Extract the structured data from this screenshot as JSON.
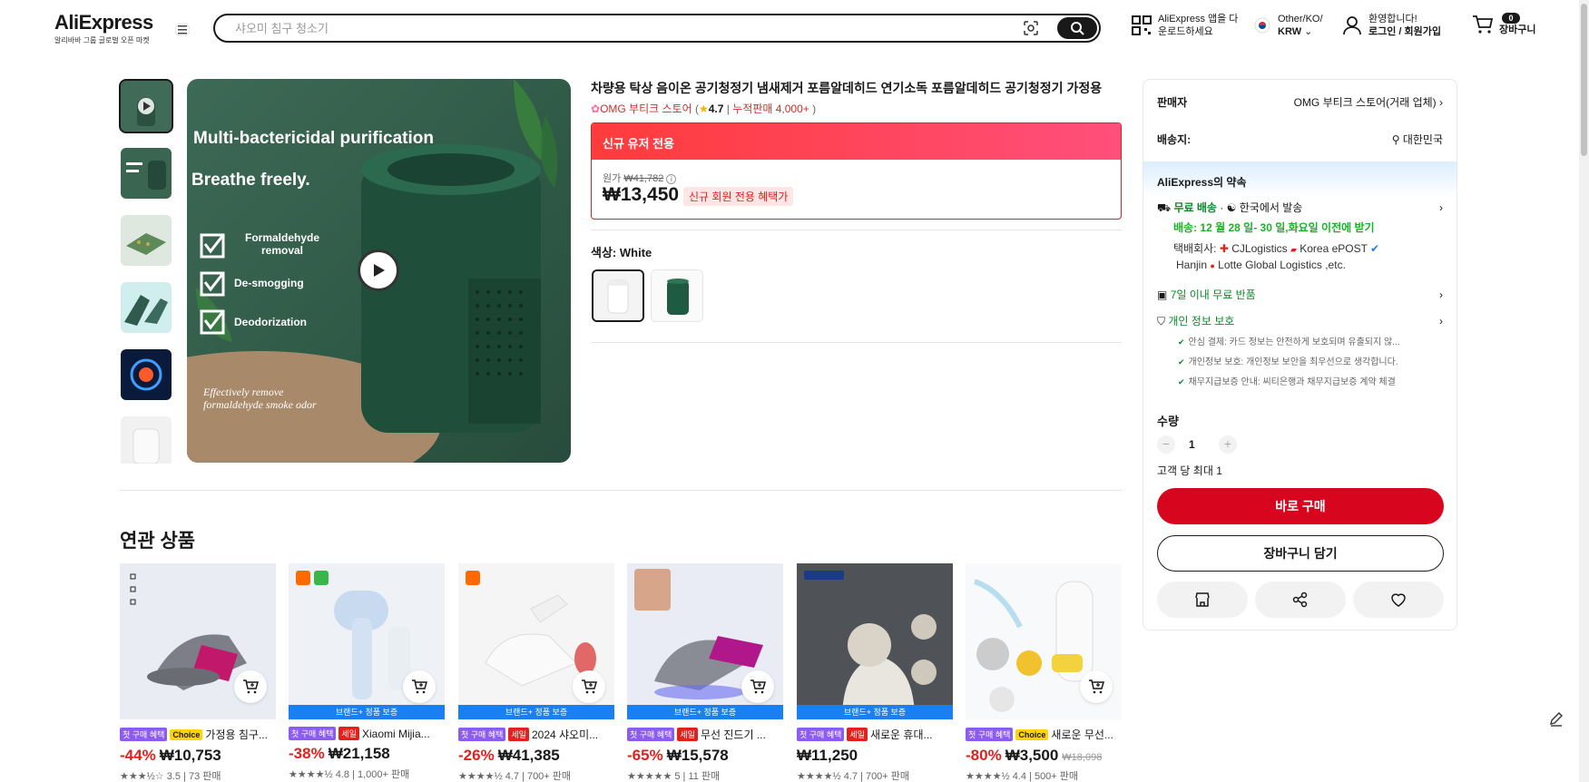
{
  "header": {
    "logo": "AliExpress",
    "logo_sub": "알리바바 그룹 글로벌 오픈 마켓",
    "search_placeholder": "샤오미 침구 청소기",
    "app_line1": "AliExpress 앱을 다",
    "app_line2": "운로드하세요",
    "region_line1": "Other/KO/",
    "region_line2": "KRW",
    "account_line1": "환영합니다!",
    "account_line2": "로그인 / 회원가입",
    "cart_count": "0",
    "cart_label": "장바구니"
  },
  "gallery": {
    "headline": "Multi-bactericidal purification",
    "sub": "Breathe freely.",
    "features": [
      "Formaldehyde removal",
      "De-smogging",
      "Deodorization"
    ],
    "bottom_note": "Effectively remove formaldehyde smoke odor"
  },
  "product": {
    "title": "차량용 탁상 음이온 공기청정기 냄새제거 포름알데히드 연기소독 포름알데히드 공기청정기 가정용",
    "store": "OMG 부티크 스토어",
    "rating": "4.7",
    "sold": "누적판매 4,000+",
    "promo_head": "신규 유저 전용",
    "orig_label": "원가",
    "orig_price": "₩41,782",
    "price": "₩13,450",
    "new_tag": "신규 회원 전용 혜택가",
    "color_label": "색상:",
    "color_value": "White"
  },
  "panel": {
    "seller_label": "판매자",
    "seller_value": "OMG 부티크 스토어(거래 업체)",
    "ship_label": "배송지:",
    "ship_value": "대한민국",
    "promise_title": "AliExpress의 약속",
    "free_ship": "무료 배송",
    "ship_from": "한국에서 발송",
    "delivery": "배송: 12 월 28 일- 30 일,화요일 이전에 받기",
    "carrier_label": "택배회사:",
    "carriers_line1": "CJLogistics",
    "carriers_line1b": "Korea ePOST",
    "carriers_line2a": "Hanjin",
    "carriers_line2b": "Lotte Global Logistics ,etc.",
    "returns": "7일 이내 무료 반품",
    "privacy": "개인 정보 보호",
    "checks": [
      "안심 결제: 카드 정보는 안전하게 보호되며 유출되지 않...",
      "개인정보 보호: 개인정보 보안을 최우선으로 생각합니다.",
      "채무지급보증 안내: 씨티은행과 채무지급보증 계약 체결"
    ],
    "qty_label": "수량",
    "qty_value": "1",
    "qty_limit": "고객 당 최대 1",
    "buy_now": "바로 구매",
    "add_cart": "장바구니 담기",
    "colors": {
      "accent": "#e2211c",
      "promise_bg": "#dceeff"
    }
  },
  "related": {
    "title": "연관 상품",
    "items": [
      {
        "tag1": "첫 구매 혜택",
        "tag2": "Choice",
        "tag2type": "choice",
        "name": "가정용 침구...",
        "disc": "-44%",
        "price": "₩10,753",
        "old": "",
        "rating": "3.5 | 73 판매",
        "brand": ""
      },
      {
        "tag1": "첫 구매 혜택",
        "tag2": "세일",
        "tag2type": "sale",
        "name": "Xiaomi Mijia...",
        "disc": "-38%",
        "price": "₩21,158",
        "old": "",
        "rating": "4.8 | 1,000+ 판매",
        "brand": "브랜드+ 정품 보증"
      },
      {
        "tag1": "첫 구매 혜택",
        "tag2": "세일",
        "tag2type": "sale",
        "name": "2024 샤오미...",
        "disc": "-26%",
        "price": "₩41,385",
        "old": "",
        "rating": "4.7 | 700+ 판매",
        "brand": "브랜드+ 정품 보증"
      },
      {
        "tag1": "첫 구매 혜택",
        "tag2": "세일",
        "tag2type": "sale",
        "name": "무선 진드기 ...",
        "disc": "-65%",
        "price": "₩15,578",
        "old": "",
        "rating": "5 | 11 판매",
        "brand": "브랜드+ 정품 보증"
      },
      {
        "tag1": "첫 구매 혜택",
        "tag2": "세일",
        "tag2type": "sale",
        "name": "새로운 휴대...",
        "disc": "",
        "price": "₩11,250",
        "old": "",
        "rating": "4.7 | 700+ 판매",
        "brand": "브랜드+ 정품 보증"
      },
      {
        "tag1": "첫 구매 혜택",
        "tag2": "Choice",
        "tag2type": "choice",
        "name": "새로운 무선...",
        "disc": "-80%",
        "price": "₩3,500",
        "old": "₩18,098",
        "rating": "4.4 | 500+ 판매",
        "brand": ""
      }
    ]
  }
}
